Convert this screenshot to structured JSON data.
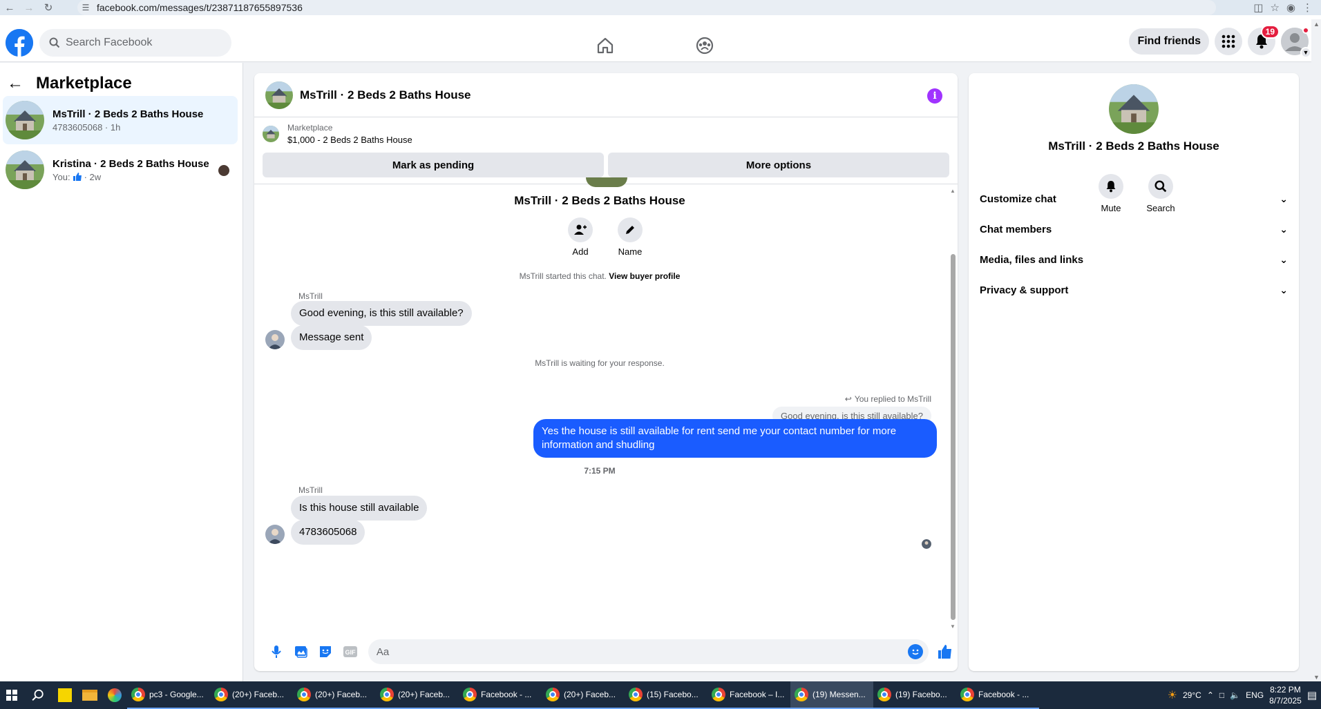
{
  "browser": {
    "url": "facebook.com/messages/t/23871187655897536"
  },
  "topbar": {
    "search_placeholder": "Search Facebook",
    "find_friends": "Find friends",
    "notification_count": "19"
  },
  "sidebar": {
    "title": "Marketplace",
    "conversations": [
      {
        "name": "MsTrill · 2 Beds 2 Baths House",
        "sub": "4783605068 · 1h"
      },
      {
        "name": "Kristina · 2 Beds 2 Baths House",
        "sub_prefix": "You:",
        "sub_suffix": "· 2w"
      }
    ]
  },
  "chat": {
    "header_name": "MsTrill · 2 Beds 2 Baths House",
    "listing_source": "Marketplace",
    "listing_title": "$1,000 - 2 Beds 2 Baths House",
    "mark_pending": "Mark as pending",
    "more_options": "More options",
    "thread_name": "MsTrill · 2 Beds 2 Baths House",
    "add_label": "Add",
    "name_label": "Name",
    "started_text": "MsTrill started this chat.",
    "view_buyer": "View buyer profile",
    "sender1": "MsTrill",
    "msg1": "Good evening, is this still available?",
    "msg2": "Message sent",
    "waiting_text": "MsTrill is waiting for your response.",
    "replied_text": "You replied to MsTrill",
    "quoted": "Good evening, is this still available?",
    "outgoing": "Yes the house is still available for rent send me your contact number for more information and shudling",
    "timestamp": "7:15 PM",
    "sender2": "MsTrill",
    "msg3": "Is this house still available",
    "msg4": "4783605068",
    "composer_placeholder": "Aa"
  },
  "details": {
    "name": "MsTrill · 2 Beds 2 Baths House",
    "mute": "Mute",
    "search": "Search",
    "sections": [
      "Customize chat",
      "Chat members",
      "Media, files and links",
      "Privacy & support"
    ]
  },
  "taskbar": {
    "tabs": [
      "pc3 - Google...",
      "(20+) Faceb...",
      "(20+) Faceb...",
      "(20+) Faceb...",
      "Facebook - ...",
      "(20+) Faceb...",
      "(15) Facebo...",
      "Facebook – I...",
      "(19) Messen...",
      "(19) Facebo...",
      "Facebook - ..."
    ],
    "weather": "29°C",
    "lang": "ENG",
    "time": "8:22 PM",
    "date": "8/7/2025"
  },
  "colors": {
    "brand": "#1877f2",
    "outgoing_bubble": "#1a5cff",
    "info_icon": "#a033ff",
    "badge": "#e41e3f"
  }
}
